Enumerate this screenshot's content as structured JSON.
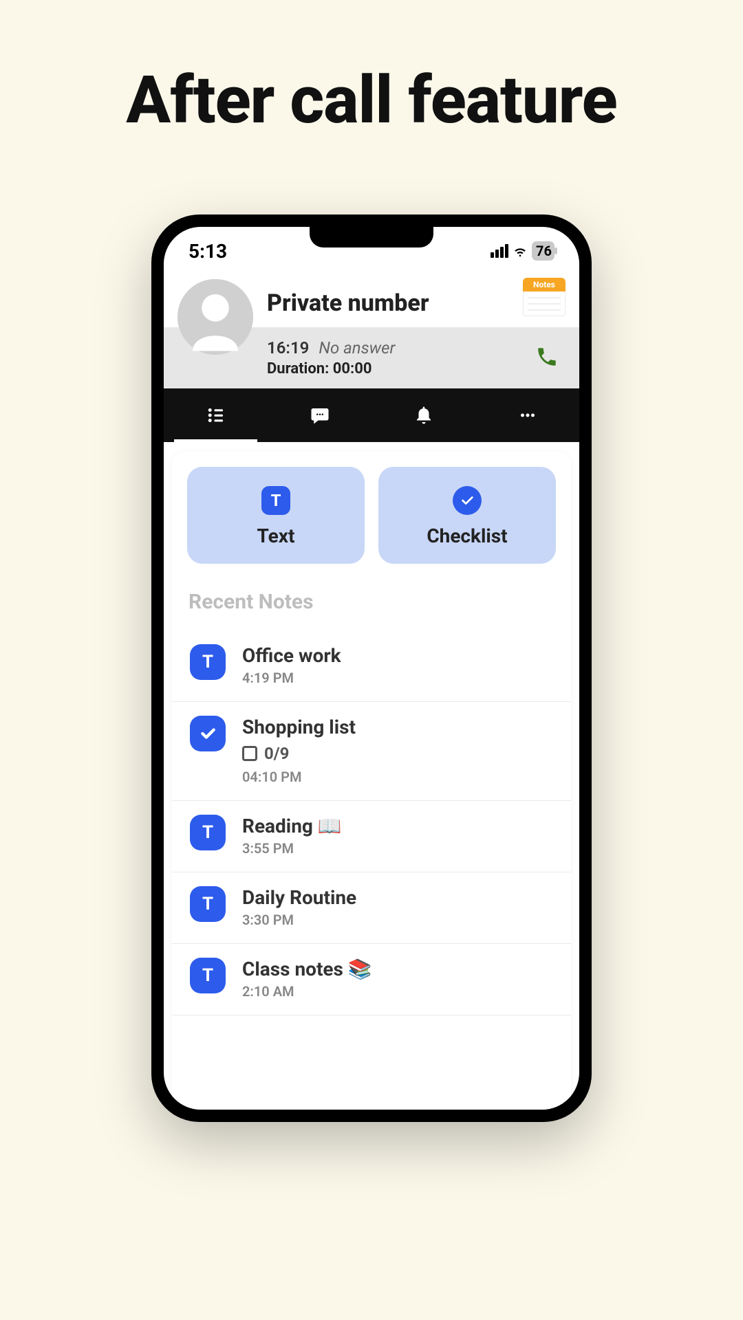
{
  "page": {
    "title": "After call feature"
  },
  "statusbar": {
    "time": "5:13",
    "battery": "76"
  },
  "caller": {
    "name": "Private number",
    "tag_label": "Notes",
    "time": "16:19",
    "status": "No answer",
    "duration_label": "Duration: 00:00"
  },
  "type_buttons": {
    "text": "Text",
    "checklist": "Checklist"
  },
  "section": {
    "recent": "Recent Notes"
  },
  "notes": [
    {
      "type": "text",
      "title": "Office work",
      "time": "4:19 PM"
    },
    {
      "type": "check",
      "title": "Shopping list",
      "progress": "0/9",
      "time": "04:10 PM"
    },
    {
      "type": "text",
      "title": "Reading 📖",
      "time": "3:55 PM"
    },
    {
      "type": "text",
      "title": "Daily Routine",
      "time": "3:30 PM"
    },
    {
      "type": "text",
      "title": "Class notes 📚",
      "time": "2:10 AM"
    }
  ]
}
